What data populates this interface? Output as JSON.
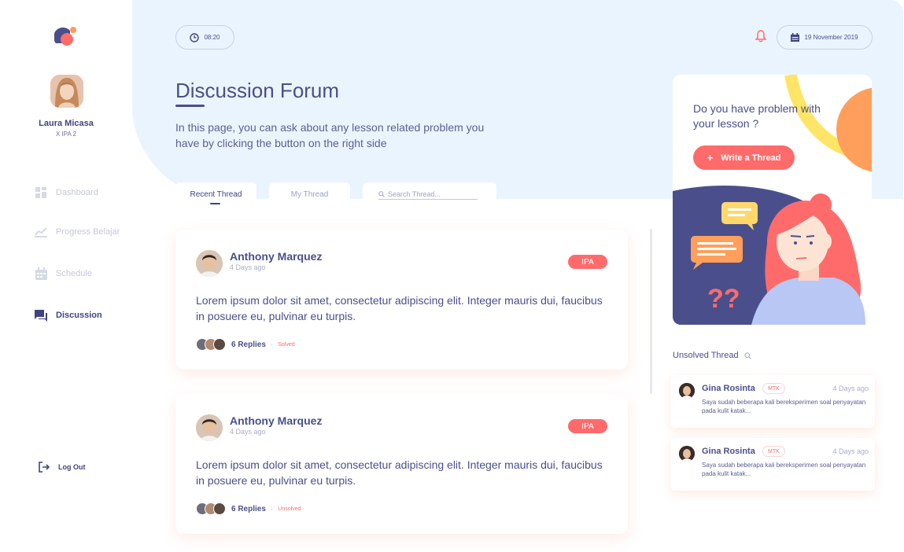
{
  "sidebar": {
    "user": {
      "name": "Laura Micasa",
      "class": "X IPA 2"
    },
    "items": [
      {
        "label": "Dashboard",
        "icon": "dashboard-icon",
        "active": false
      },
      {
        "label": "Progress Belajar",
        "icon": "chart-icon",
        "active": false
      },
      {
        "label": "Schedule",
        "icon": "calendar-icon",
        "active": false
      },
      {
        "label": "Discussion",
        "icon": "chat-icon",
        "active": true
      }
    ],
    "logout_label": "Log Out"
  },
  "header": {
    "time": "08:20",
    "date": "19 November 2019"
  },
  "main": {
    "title": "Discussion Forum",
    "description": "In this page, you can ask about any lesson related problem you have by clicking the button on the right side",
    "tabs": [
      {
        "label": "Recent Thread",
        "active": true
      },
      {
        "label": "My Thread",
        "active": false
      }
    ],
    "search_placeholder": "Search Thread...",
    "threads": [
      {
        "author": "Anthony Marquez",
        "time": "4 Days ago",
        "subject": "IPA",
        "body": "Lorem ipsum dolor sit amet, consectetur adipiscing elit. Integer mauris dui, faucibus in posuere eu, pulvinar eu turpis.",
        "replies": "6 Replies",
        "status": "Solved"
      },
      {
        "author": "Anthony Marquez",
        "time": "4 Days ago",
        "subject": "IPA",
        "body": "Lorem ipsum dolor sit amet, consectetur adipiscing elit. Integer mauris dui, faucibus in posuere eu, pulvinar eu turpis.",
        "replies": "6 Replies",
        "status": "Unsolved"
      }
    ]
  },
  "promo": {
    "text": "Do you have problem with your lesson ?",
    "button": "Write a Thread"
  },
  "unsolved": {
    "title": "Unsolved Thread",
    "items": [
      {
        "name": "Gina Rosinta",
        "subject": "MTK",
        "time": "4 Days ago",
        "body": "Saya sudah beberapa kali bereksperimen soal penyayatan pada kulit katak..."
      },
      {
        "name": "Gina Rosinta",
        "subject": "MTK",
        "time": "4 Days ago",
        "body": "Saya sudah beberapa kali bereksperimen soal penyayatan pada kulit katak..."
      }
    ]
  },
  "colors": {
    "primary": "#4a4f8c",
    "accent": "#ff6b6b",
    "hero_bg": "#eaf4fe",
    "inactive": "#c5c8d8"
  }
}
